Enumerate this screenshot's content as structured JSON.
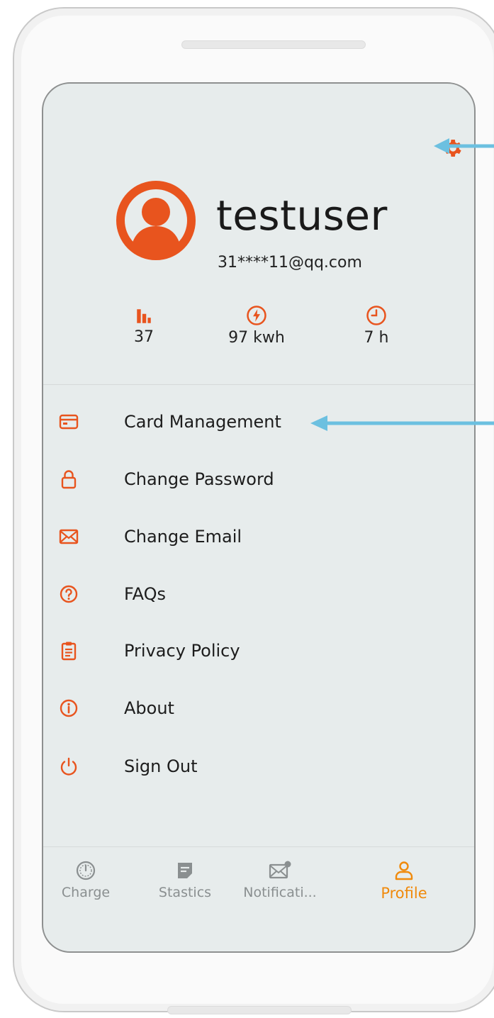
{
  "profile": {
    "username": "testuser",
    "email": "31****11@qq.com"
  },
  "stats": {
    "count": "37",
    "energy": "97 kwh",
    "time": "7 h"
  },
  "menu": {
    "items": [
      {
        "label": "Card Management",
        "icon": "card-icon"
      },
      {
        "label": "Change Password",
        "icon": "lock-icon"
      },
      {
        "label": "Change Email",
        "icon": "mail-icon"
      },
      {
        "label": "FAQs",
        "icon": "help-icon"
      },
      {
        "label": "Privacy Policy",
        "icon": "clipboard-icon"
      },
      {
        "label": "About",
        "icon": "info-icon"
      },
      {
        "label": "Sign Out",
        "icon": "power-icon"
      }
    ]
  },
  "tabs": [
    {
      "label": "Charge",
      "icon": "gauge-icon",
      "active": false
    },
    {
      "label": "Stastics",
      "icon": "note-icon",
      "active": false
    },
    {
      "label": "Notificati...",
      "icon": "notification-icon",
      "active": false
    },
    {
      "label": "Profile",
      "icon": "person-icon",
      "active": true
    }
  ],
  "colors": {
    "accent": "#e8541e",
    "active_tab": "#f08a0c",
    "inactive_tab": "#8a8f90",
    "screen_bg": "#e7ecec",
    "annotation_arrow": "#6cc0e0"
  }
}
